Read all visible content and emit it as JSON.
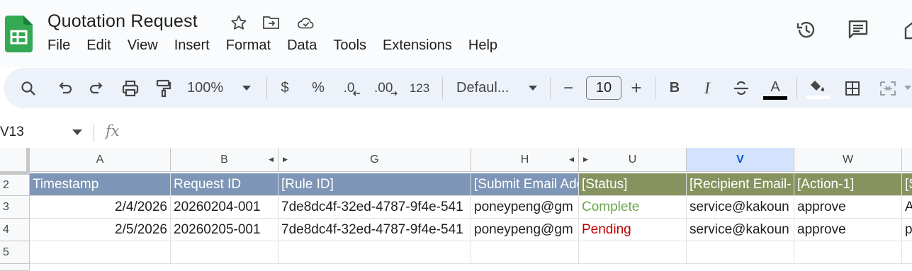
{
  "doc": {
    "title": "Quotation Request"
  },
  "menu": [
    "File",
    "Edit",
    "View",
    "Insert",
    "Format",
    "Data",
    "Tools",
    "Extensions",
    "Help"
  ],
  "toolbar": {
    "zoom": "100%",
    "currency": "$",
    "percent": "%",
    "dec_decrease": ".0",
    "dec_increase": ".00",
    "format_more": "123",
    "font": "Defaul...",
    "font_size": "10",
    "bold": "B",
    "italic": "I",
    "text_color_glyph": "A",
    "minus": "−",
    "plus": "+"
  },
  "formula": {
    "name_box": "V13",
    "fx": "fx"
  },
  "columns": [
    {
      "key": "A",
      "label": "A"
    },
    {
      "key": "B",
      "label": "B"
    },
    {
      "key": "G",
      "label": "G"
    },
    {
      "key": "H",
      "label": "H"
    },
    {
      "key": "U",
      "label": "U"
    },
    {
      "key": "V",
      "label": "V"
    },
    {
      "key": "W",
      "label": "W"
    }
  ],
  "rows": [
    {
      "num": "2",
      "cells": [
        "Timestamp",
        "Request ID",
        "[Rule ID]",
        "[Submit Email Address]",
        "[Status]",
        "[Recipient Email-",
        "[Action-1]",
        "[S"
      ]
    },
    {
      "num": "3",
      "cells": [
        "2/4/2026",
        "20260204-001",
        "7de8dc4f-32ed-4787-9f4e-541",
        "poneypeng@gm",
        "Complete",
        "service@kakoun",
        "approve",
        "A"
      ]
    },
    {
      "num": "4",
      "cells": [
        "2/5/2026",
        "20260205-001",
        "7de8dc4f-32ed-4787-9f4e-541",
        "poneypeng@gm",
        "Pending",
        "service@kakoun",
        "approve",
        "p"
      ]
    },
    {
      "num": "5",
      "cells": [
        "",
        "",
        "",
        "",
        "",
        "",
        "",
        ""
      ]
    }
  ],
  "colors": {
    "header_blue": "#7d95b6",
    "header_green": "#87935f",
    "status_complete": "#6aa84f",
    "status_pending": "#c00000",
    "selected_col": "#d3e3fd"
  }
}
